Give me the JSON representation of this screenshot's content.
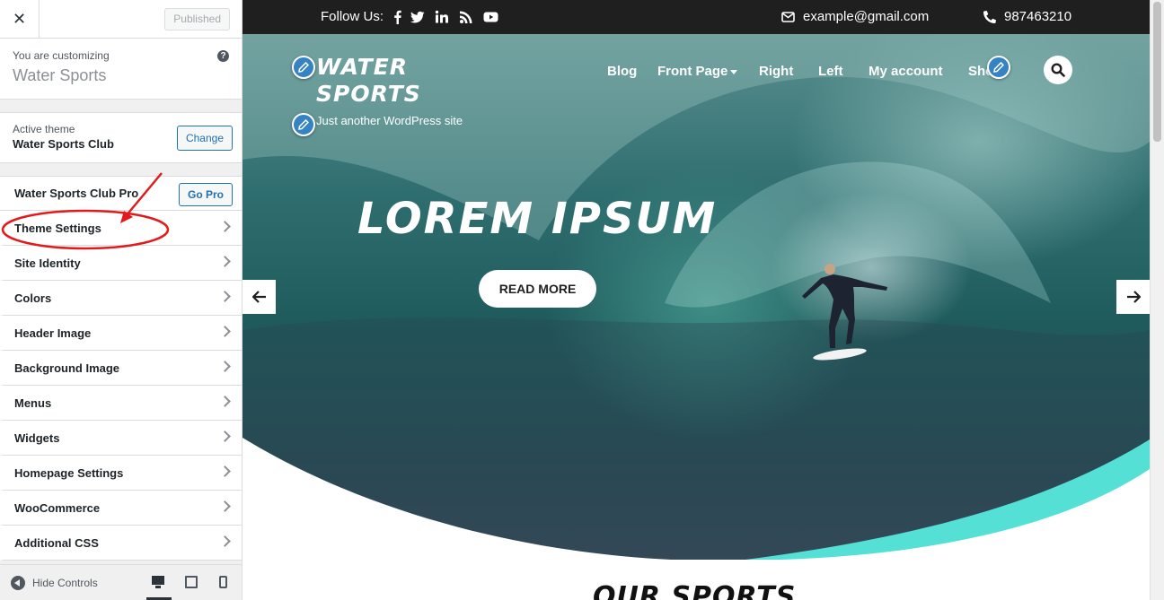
{
  "customizer": {
    "close_icon": "close-icon",
    "published_label": "Published",
    "customizing_label": "You are customizing",
    "site_name": "Water Sports",
    "help_label": "?",
    "active_theme_label": "Active theme",
    "active_theme_name": "Water Sports Club",
    "change_label": "Change",
    "pro": {
      "label": "Water Sports Club Pro",
      "button": "Go Pro"
    },
    "sections": [
      {
        "label": "Theme Settings"
      },
      {
        "label": "Site Identity"
      },
      {
        "label": "Colors"
      },
      {
        "label": "Header Image"
      },
      {
        "label": "Background Image"
      },
      {
        "label": "Menus"
      },
      {
        "label": "Widgets"
      },
      {
        "label": "Homepage Settings"
      },
      {
        "label": "WooCommerce"
      },
      {
        "label": "Additional CSS"
      }
    ],
    "footer": {
      "hide_controls": "Hide Controls"
    }
  },
  "preview": {
    "topbar": {
      "follow_label": "Follow Us:",
      "email": "example@gmail.com",
      "phone": "987463210"
    },
    "site_title": "Water Sports",
    "tagline": "Just another WordPress site",
    "nav": [
      "Blog",
      "Front Page",
      "Right",
      "Left",
      "My account",
      "Shop"
    ],
    "hero": {
      "title": "Lorem Ipsum",
      "button": "READ MORE"
    },
    "section_title_partial": "Our Sports"
  },
  "colors": {
    "accent_blue": "#2271b1",
    "topbar_bg": "#1f1f1f",
    "wave_turquoise": "#55e0d6",
    "annotation_red": "#e11b1b"
  }
}
